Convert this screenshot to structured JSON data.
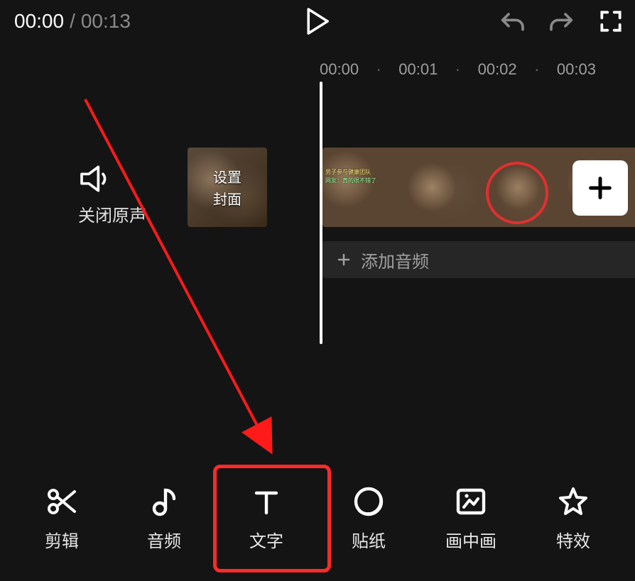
{
  "topbar": {
    "current_time": "00:00",
    "separator": " / ",
    "total_time": "00:13"
  },
  "ruler": {
    "t0": "00:00",
    "t1": "00:01",
    "t2": "00:02",
    "t3": "00:03"
  },
  "mute": {
    "label": "关闭原声"
  },
  "cover": {
    "line1": "设置",
    "line2": "封面"
  },
  "audio_track": {
    "label": "添加音频"
  },
  "tools": {
    "edit": {
      "label": "剪辑"
    },
    "audio": {
      "label": "音频"
    },
    "text": {
      "label": "文字"
    },
    "sticker": {
      "label": "贴纸"
    },
    "pip": {
      "label": "画中画"
    },
    "effect": {
      "label": "特效"
    }
  },
  "highlighted_tool": "text",
  "icons": {
    "play": "play-icon",
    "undo": "undo-icon",
    "redo": "redo-icon",
    "fullscreen": "fullscreen-icon",
    "mute": "speaker-icon",
    "add_clip": "plus-icon",
    "add_audio": "plus-icon"
  }
}
